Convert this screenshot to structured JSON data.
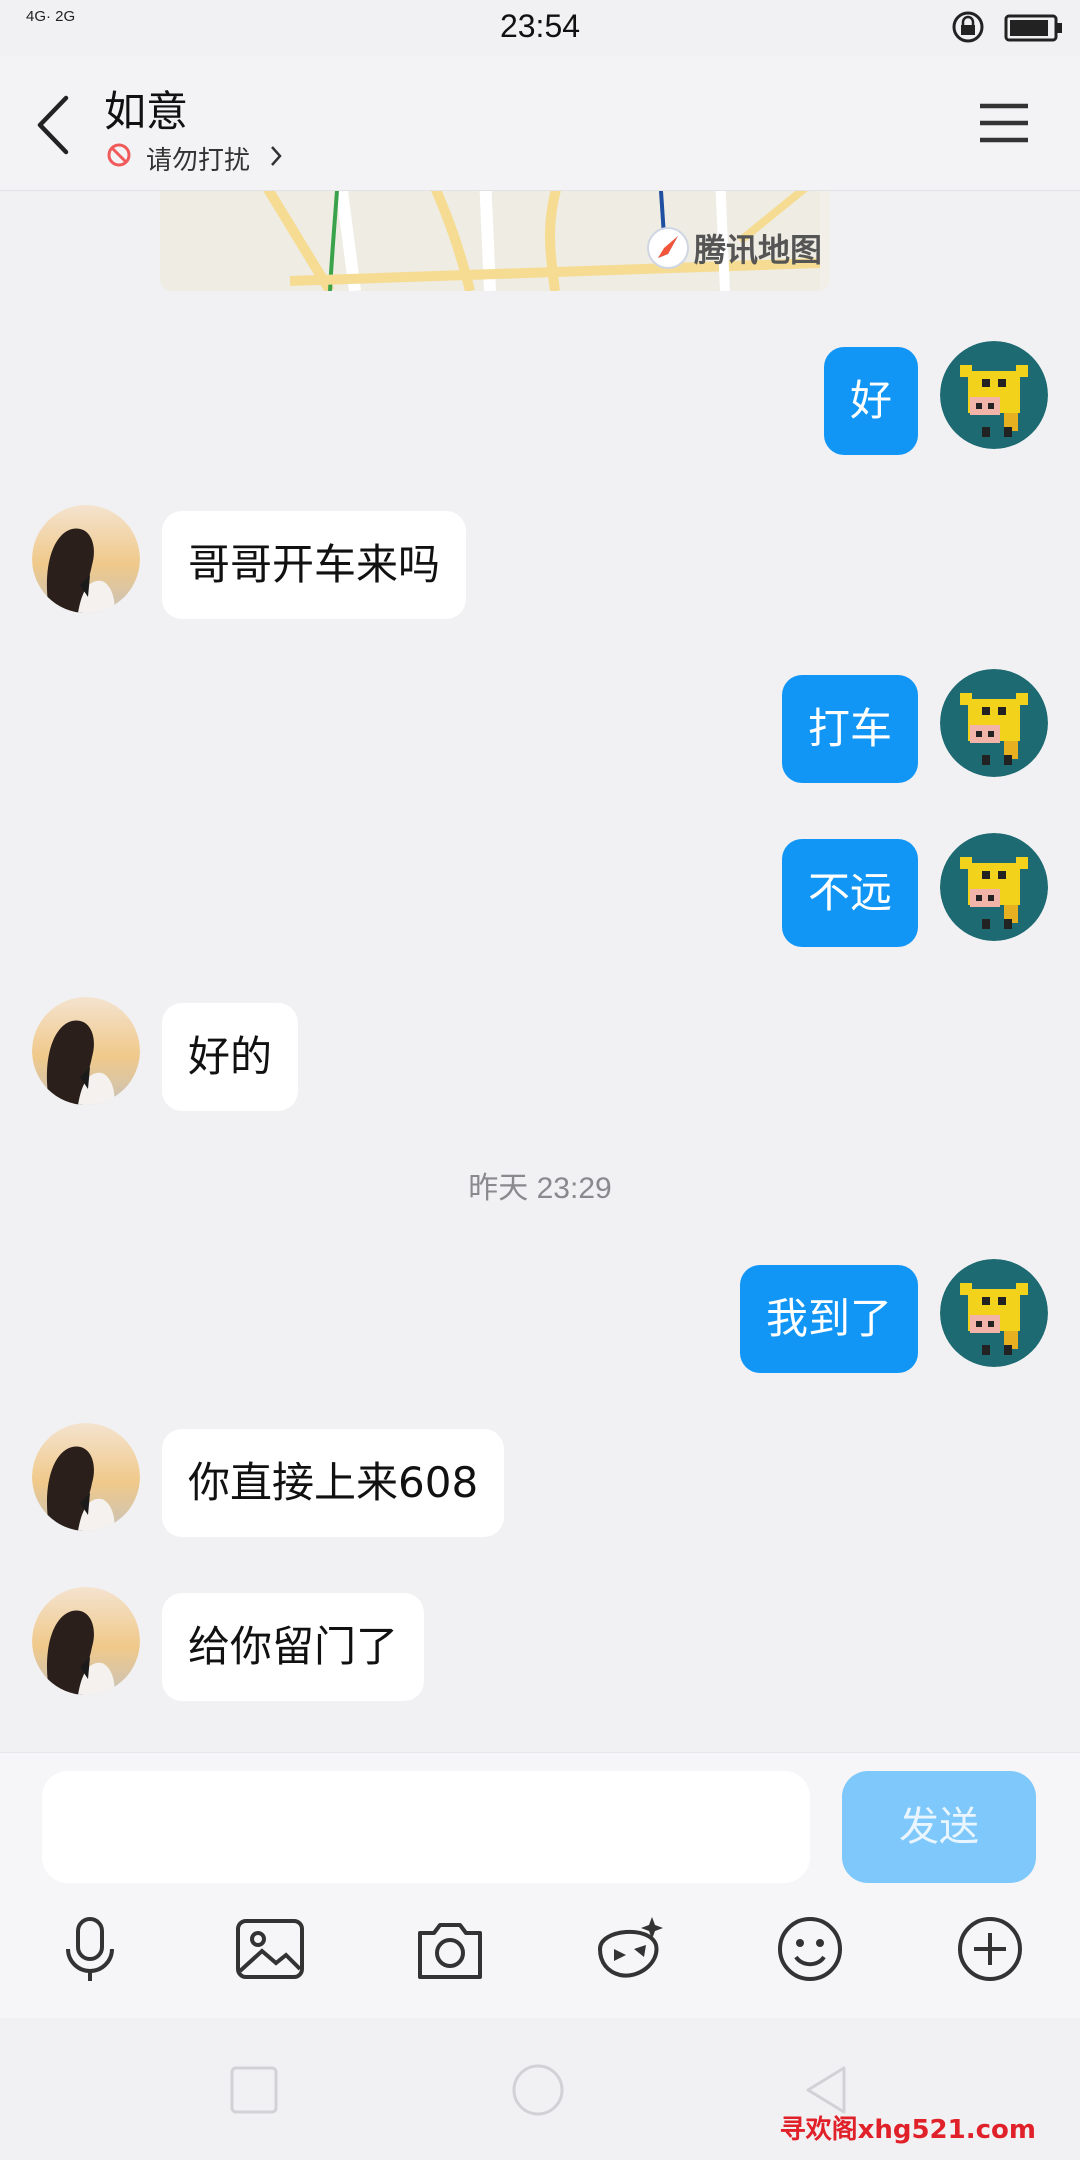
{
  "status_bar": {
    "network": "4G· 2G",
    "time": "23:54"
  },
  "header": {
    "title": "如意",
    "status": "请勿打扰"
  },
  "map": {
    "provider": "腾讯地图"
  },
  "messages": [
    {
      "side": "out",
      "text": "好"
    },
    {
      "side": "in",
      "text": "哥哥开车来吗"
    },
    {
      "side": "out",
      "text": "打车"
    },
    {
      "side": "out",
      "text": "不远"
    },
    {
      "side": "in",
      "text": "好的"
    },
    {
      "side": "out",
      "text": "我到了"
    },
    {
      "side": "in",
      "text": "你直接上来608"
    },
    {
      "side": "in",
      "text": "给你留门了"
    }
  ],
  "timestamp": "昨天 23:29",
  "input": {
    "value": "",
    "send_label": "发送"
  },
  "toolbar": [
    "microphone-icon",
    "image-icon",
    "camera-icon",
    "sticker-icon",
    "emoji-icon",
    "plus-icon"
  ],
  "watermark": "寻欢阁xhg521.com",
  "colors": {
    "accent": "#1296f6",
    "send_disabled": "#7ec8fb",
    "background": "#f1f1f3"
  }
}
